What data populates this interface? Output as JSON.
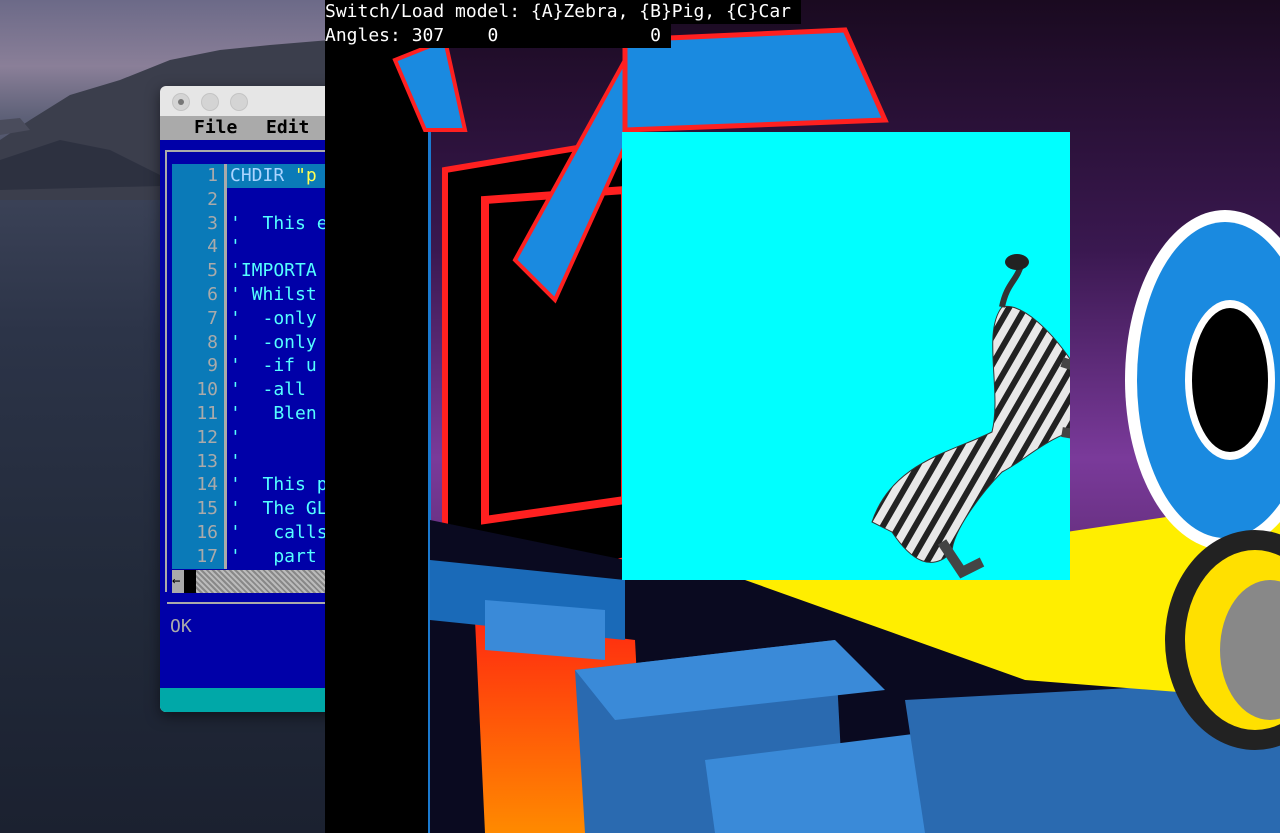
{
  "editor": {
    "menu": [
      "File",
      "Edit"
    ],
    "lines": [
      {
        "n": "1",
        "text": "CHDIR ",
        "str": "\"p"
      },
      {
        "n": "2",
        "text": ""
      },
      {
        "n": "3",
        "text": "'  This e"
      },
      {
        "n": "4",
        "text": "'"
      },
      {
        "n": "5",
        "text": "'IMPORTA"
      },
      {
        "n": "6",
        "text": "' Whilst"
      },
      {
        "n": "7",
        "text": "'  -only"
      },
      {
        "n": "8",
        "text": "'  -only"
      },
      {
        "n": "9",
        "text": "'  -if u"
      },
      {
        "n": "10",
        "text": "'  -all"
      },
      {
        "n": "11",
        "text": "'   Blen"
      },
      {
        "n": "12",
        "text": "'"
      },
      {
        "n": "13",
        "text": "'"
      },
      {
        "n": "14",
        "text": "'  This p"
      },
      {
        "n": "15",
        "text": "'  The GL"
      },
      {
        "n": "16",
        "text": "'   calls"
      },
      {
        "n": "17",
        "text": "'   part"
      }
    ],
    "scroll_arrow": "←",
    "status": "OK"
  },
  "game": {
    "hud_line1": "Switch/Load model: {A}Zebra, {B}Pig, {C}Car",
    "hud_line2": "Angles: 307    0              0"
  }
}
